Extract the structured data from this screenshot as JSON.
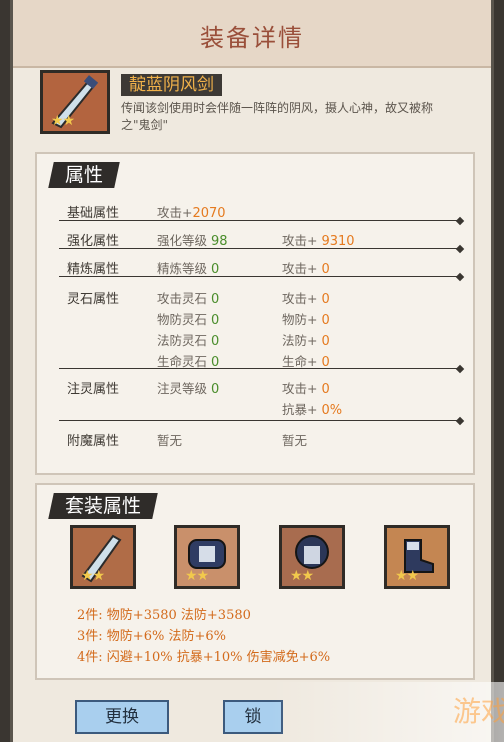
{
  "window": {
    "title": "装备详情"
  },
  "item": {
    "name": "靛蓝阴风剑",
    "stars": "★★",
    "description": "传闻该剑使用时会伴随一阵阵的阴风，摄人心神，故又被称之\"鬼剑\""
  },
  "attributes": {
    "heading": "属性",
    "base": {
      "label": "基础属性",
      "text": "攻击+",
      "value": "2070"
    },
    "enhance": {
      "label": "强化属性",
      "level_text": "强化等级",
      "level": "98",
      "atk_text": "攻击+",
      "atk": "9310"
    },
    "refine": {
      "label": "精炼属性",
      "level_text": "精炼等级",
      "level": "0",
      "atk_text": "攻击+",
      "atk": "0"
    },
    "spirit_stone": {
      "label": "灵石属性",
      "left": [
        {
          "text": "攻击灵石",
          "value": "0"
        },
        {
          "text": "物防灵石",
          "value": "0"
        },
        {
          "text": "法防灵石",
          "value": "0"
        },
        {
          "text": "生命灵石",
          "value": "0"
        }
      ],
      "right": [
        {
          "text": "攻击+",
          "value": "0"
        },
        {
          "text": "物防+",
          "value": "0"
        },
        {
          "text": "法防+",
          "value": "0"
        },
        {
          "text": "生命+",
          "value": "0"
        }
      ]
    },
    "infuse": {
      "label": "注灵属性",
      "level_text": "注灵等级",
      "level": "0",
      "atk_text": "攻击+",
      "atk": "0",
      "crit_text": "抗暴+",
      "crit": "0%"
    },
    "enchant": {
      "label": "附魔属性",
      "left": "暂无",
      "right": "暂无"
    }
  },
  "set": {
    "heading": "套装属性",
    "icons": [
      {
        "name": "sword-icon",
        "stars": "★★"
      },
      {
        "name": "armor-icon",
        "stars": "★★"
      },
      {
        "name": "helmet-armor-icon",
        "stars": "★★"
      },
      {
        "name": "boots-icon",
        "stars": "★★"
      }
    ],
    "bonuses": [
      {
        "count": "2件:",
        "text": "物防+3580  法防+3580"
      },
      {
        "count": "3件:",
        "text": "物防+6%  法防+6%"
      },
      {
        "count": "4件:",
        "text": "闪避+10%  抗暴+10%  伤害减免+6%"
      }
    ]
  },
  "buttons": {
    "swap": "更换",
    "lock": "锁"
  },
  "watermark": "游戏"
}
